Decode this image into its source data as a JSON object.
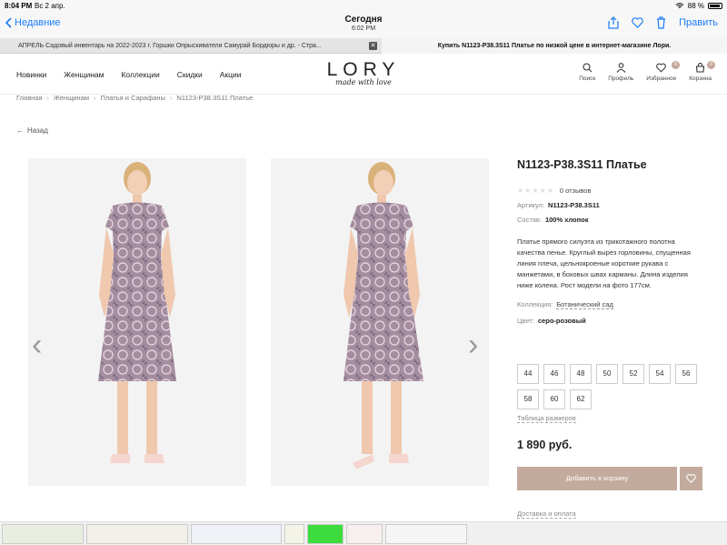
{
  "status_bar": {
    "time": "8:04 PM",
    "date": "Вс 2 апр.",
    "battery": "88 %"
  },
  "navbar": {
    "back": "Недавние",
    "title": "Сегодня",
    "subtitle": "6:02 PM",
    "edit": "Править"
  },
  "tabs": {
    "left": "АПРЕЛЬ Садовый инвентарь на 2022-2023 г. Горшки Опрыскиватели Самурай Бордюры и др. - Стра...",
    "close": "✕",
    "right": "Купить N1123-P38.3S11 Платье по низкой цене в интернет-магазине Лори."
  },
  "header": {
    "nav": [
      "Новинки",
      "Женщинам",
      "Коллекции",
      "Скидки",
      "Акции"
    ],
    "logo_main": "LORY",
    "logo_sub": "made with love",
    "icons": [
      {
        "label": "Поиск",
        "icon": "search-icon"
      },
      {
        "label": "Профиль",
        "icon": "user-icon"
      },
      {
        "label": "Избранное",
        "icon": "heart-icon",
        "badge": "0"
      },
      {
        "label": "Корзина",
        "icon": "bag-icon",
        "badge": "0"
      }
    ]
  },
  "breadcrumb": [
    "Главная",
    "Женщинам",
    "Платья и Сарафаны",
    "N1123-P38.3S11 Платье"
  ],
  "back_link": "Назад",
  "product": {
    "title": "N1123-P38.3S11 Платье",
    "reviews": "0 отзывов",
    "sku_label": "Артикул:",
    "sku": "N1123-P38.3S11",
    "composition_label": "Состав:",
    "composition": "100% хлопок",
    "description": "Платье прямого силуэта из трикотажного полотна качества пенье. Круглый вырез горловины, спущенная линия плеча, цельнокроеные короткие рукава с манжетами, в боковых швах карманы. Длина изделия ниже колена. Рост модели на фото 177см.",
    "collection_label": "Коллекция:",
    "collection": "Ботанический сад",
    "color_label": "Цвет:",
    "color": "серо-розовый",
    "sizes": [
      "44",
      "46",
      "48",
      "50",
      "52",
      "54",
      "56",
      "58",
      "60",
      "62"
    ],
    "size_table": "Таблица размеров",
    "price": "1 890 руб.",
    "add_to_cart": "Добавить в корзину",
    "delivery": "Доставка и оплата"
  },
  "colors": {
    "accent": "#c2aa9d",
    "link": "#1a7cf5",
    "dress": "#9b7f95"
  }
}
